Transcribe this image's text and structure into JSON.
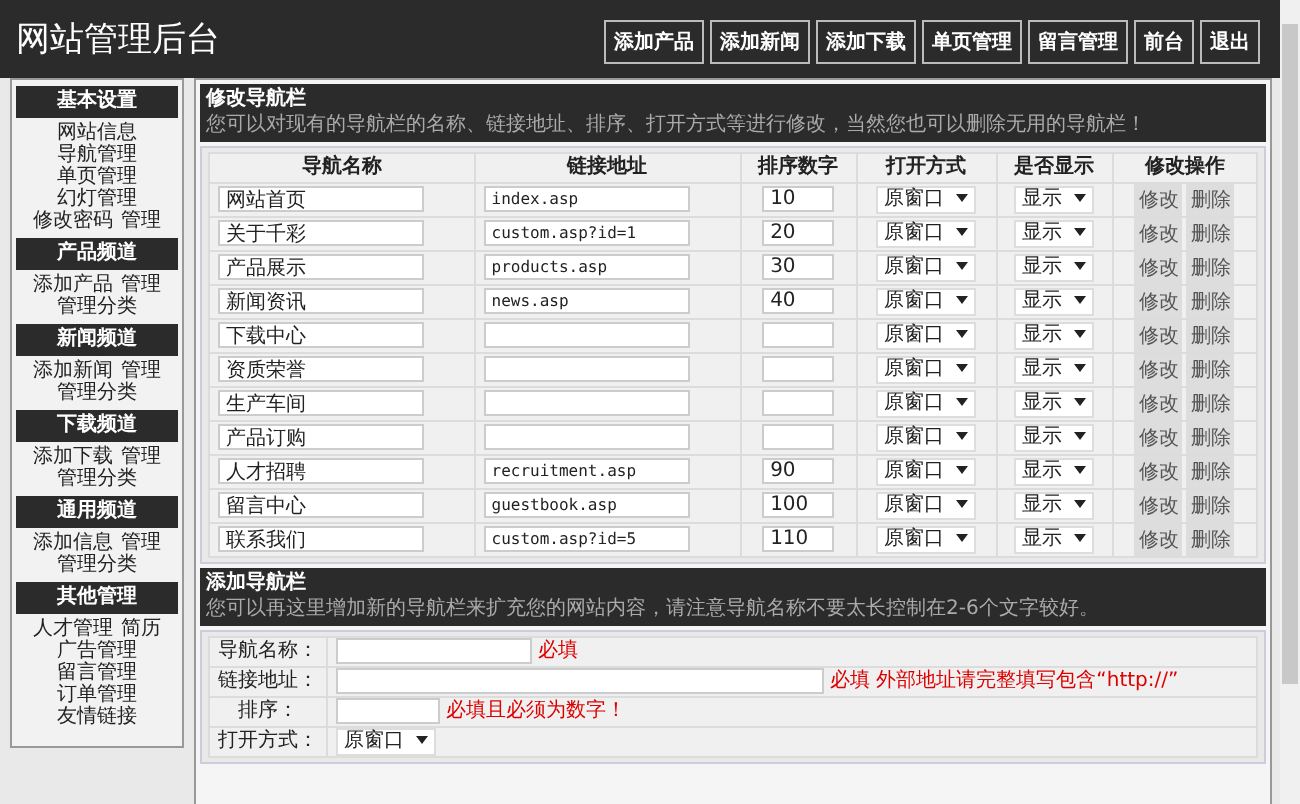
{
  "header": {
    "title": "网站管理后台",
    "buttons": [
      "添加产品",
      "添加新闻",
      "添加下载",
      "单页管理",
      "留言管理",
      "前台",
      "退出"
    ]
  },
  "sidebar": [
    {
      "heading": "基本设置",
      "lines": [
        [
          "网站信息"
        ],
        [
          "导航管理"
        ],
        [
          "单页管理"
        ],
        [
          "幻灯管理"
        ],
        [
          "修改密码",
          "管理"
        ]
      ]
    },
    {
      "heading": "产品频道",
      "lines": [
        [
          "添加产品",
          "管理"
        ],
        [
          "管理分类"
        ]
      ]
    },
    {
      "heading": "新闻频道",
      "lines": [
        [
          "添加新闻",
          "管理"
        ],
        [
          "管理分类"
        ]
      ]
    },
    {
      "heading": "下载频道",
      "lines": [
        [
          "添加下载",
          "管理"
        ],
        [
          "管理分类"
        ]
      ]
    },
    {
      "heading": "通用频道",
      "lines": [
        [
          "添加信息",
          "管理"
        ],
        [
          "管理分类"
        ]
      ]
    },
    {
      "heading": "其他管理",
      "lines": [
        [
          "人才管理",
          "简历"
        ],
        [
          "广告管理"
        ],
        [
          "留言管理"
        ],
        [
          "订单管理"
        ],
        [
          "友情链接"
        ]
      ]
    }
  ],
  "edit_section": {
    "title": "修改导航栏",
    "description": "您可以对现有的导航栏的名称、链接地址、排序、打开方式等进行修改，当然您也可以删除无用的导航栏！",
    "columns": [
      "导航名称",
      "链接地址",
      "排序数字",
      "打开方式",
      "是否显示",
      "修改操作"
    ],
    "rows": [
      {
        "name": "网站首页",
        "link": "index.asp",
        "sort": "10",
        "open_mode": "原窗口",
        "display": "显示",
        "actions": [
          "修改",
          "删除"
        ]
      },
      {
        "name": "关于千彩",
        "link": "custom.asp?id=1",
        "sort": "20",
        "open_mode": "原窗口",
        "display": "显示",
        "actions": [
          "修改",
          "删除"
        ]
      },
      {
        "name": "产品展示",
        "link": "products.asp",
        "sort": "30",
        "open_mode": "原窗口",
        "display": "显示",
        "actions": [
          "修改",
          "删除"
        ]
      },
      {
        "name": "新闻资讯",
        "link": "news.asp",
        "sort": "40",
        "open_mode": "原窗口",
        "display": "显示",
        "actions": [
          "修改",
          "删除"
        ]
      },
      {
        "name": "下载中心",
        "open_mode": "原窗口",
        "display": "显示",
        "actions": [
          "修改",
          "删除"
        ]
      },
      {
        "name": "资质荣誉",
        "open_mode": "原窗口",
        "display": "显示",
        "actions": [
          "修改",
          "删除"
        ]
      },
      {
        "name": "生产车间",
        "open_mode": "原窗口",
        "display": "显示",
        "actions": [
          "修改",
          "删除"
        ]
      },
      {
        "name": "产品订购",
        "open_mode": "原窗口",
        "display": "显示",
        "actions": [
          "修改",
          "删除"
        ]
      },
      {
        "name": "人才招聘",
        "link": "recruitment.asp",
        "sort": "90",
        "open_mode": "原窗口",
        "display": "显示",
        "actions": [
          "修改",
          "删除"
        ]
      },
      {
        "name": "留言中心",
        "link": "guestbook.asp",
        "sort": "100",
        "open_mode": "原窗口",
        "display": "显示",
        "actions": [
          "修改",
          "删除"
        ]
      },
      {
        "name": "联系我们",
        "link": "custom.asp?id=5",
        "sort": "110",
        "open_mode": "原窗口",
        "display": "显示",
        "actions": [
          "修改",
          "删除"
        ]
      }
    ]
  },
  "add_section": {
    "title": "添加导航栏",
    "description": "您可以再这里增加新的导航栏来扩充您的网站内容，请注意导航名称不要太长控制在2-6个文字较好。",
    "fields": [
      {
        "label": "导航名称：",
        "kind": "text",
        "hint": "必填"
      },
      {
        "label": "链接地址：",
        "kind": "url",
        "hint": "必填 外部地址请完整填写包含“http://”"
      },
      {
        "label": "排序：",
        "kind": "number",
        "hint": "必填且必须为数字！"
      },
      {
        "label": "打开方式：",
        "kind": "select",
        "value": "原窗口"
      }
    ]
  }
}
